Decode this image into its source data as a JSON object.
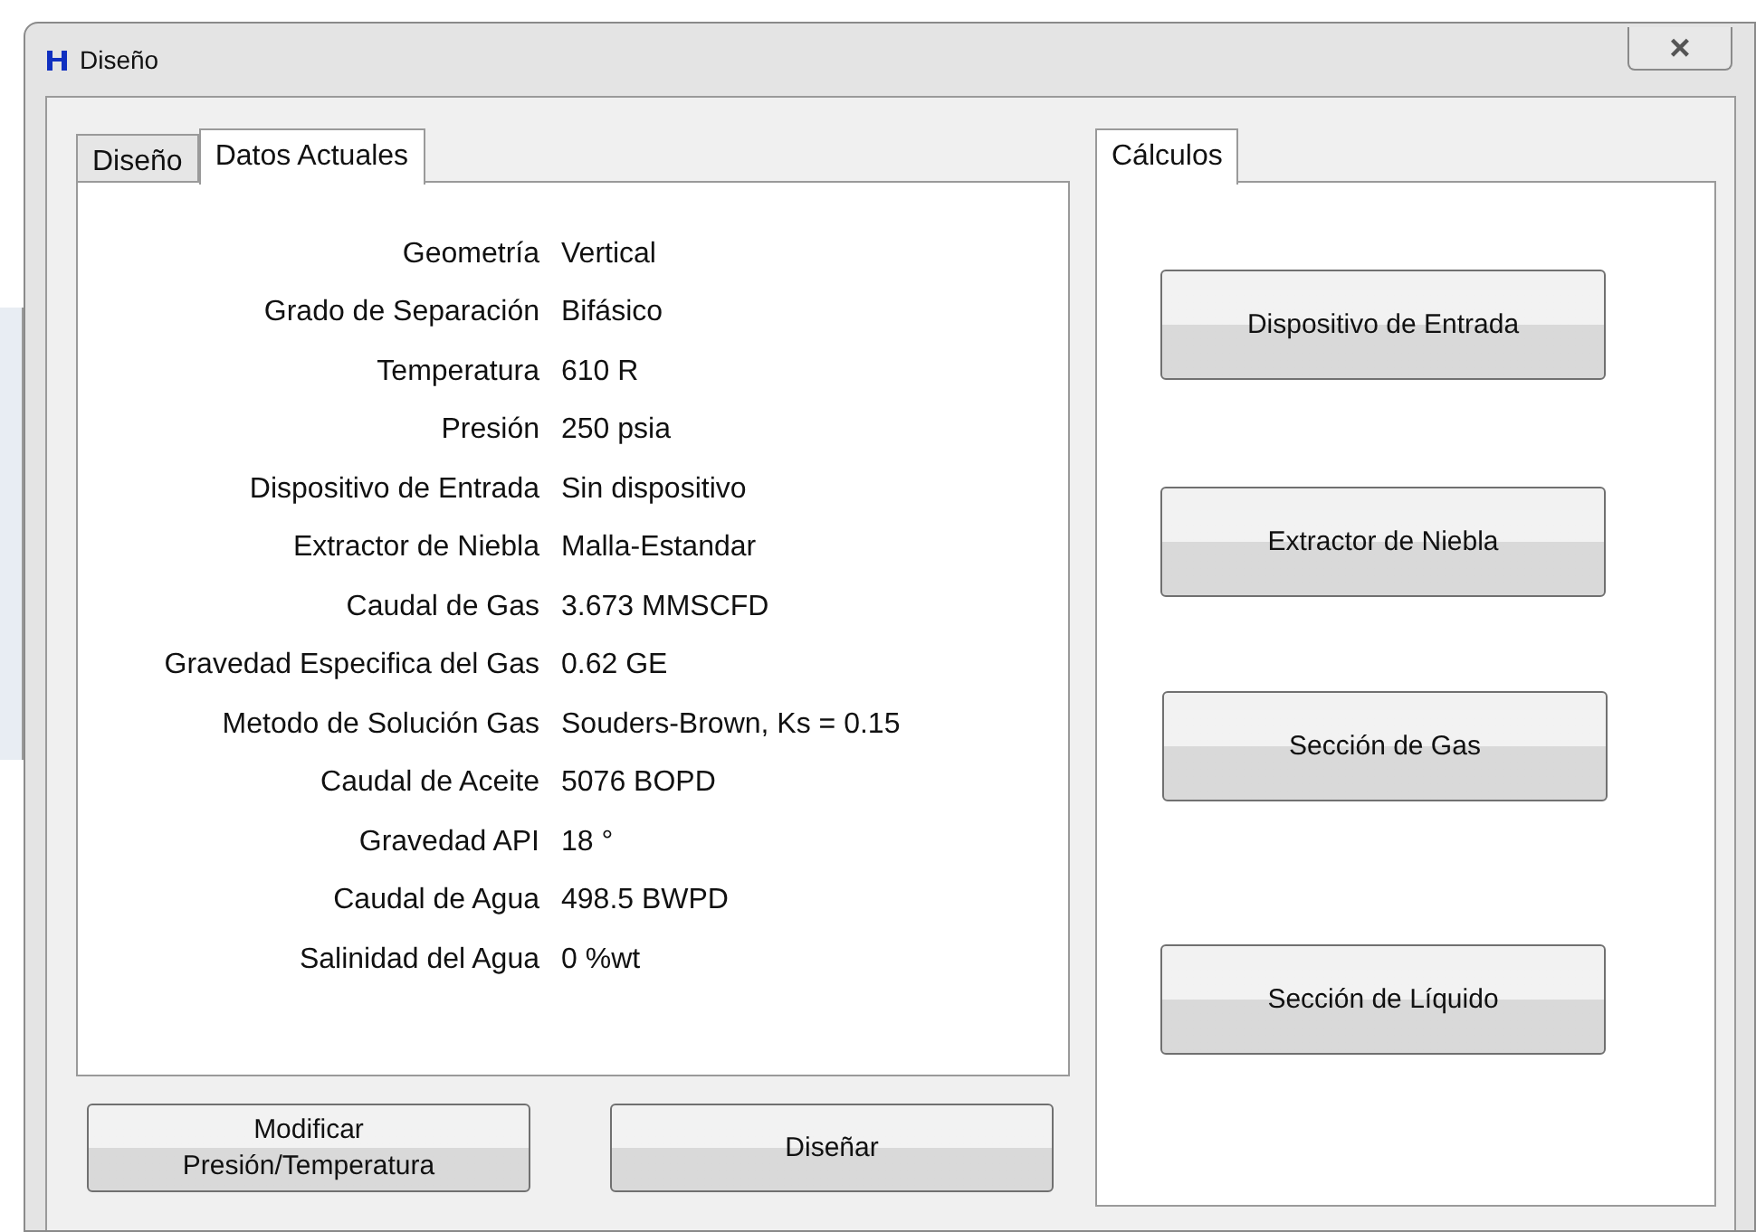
{
  "window": {
    "title": "Diseño",
    "close": "×"
  },
  "left_tabs": [
    {
      "label": "Diseño",
      "selected": false
    },
    {
      "label": "Datos Actuales",
      "selected": true
    }
  ],
  "fields": [
    {
      "label": "Geometría",
      "value": "Vertical"
    },
    {
      "label": "Grado de Separación",
      "value": "Bifásico"
    },
    {
      "label": "Temperatura",
      "value": "610 R"
    },
    {
      "label": "Presión",
      "value": "250 psia"
    },
    {
      "label": "Dispositivo de Entrada",
      "value": "Sin dispositivo"
    },
    {
      "label": "Extractor de Niebla",
      "value": "Malla-Estandar"
    },
    {
      "label": "Caudal de Gas",
      "value": "3.673 MMSCFD"
    },
    {
      "label": "Gravedad Especifica del Gas",
      "value": "0.62 GE"
    },
    {
      "label": "Metodo de Solución Gas",
      "value": "Souders-Brown, Ks = 0.15"
    },
    {
      "label": "Caudal de Aceite",
      "value": "5076 BOPD"
    },
    {
      "label": "Gravedad API",
      "value": "18 °"
    },
    {
      "label": "Caudal de Agua",
      "value": "498.5 BWPD"
    },
    {
      "label": "Salinidad del Agua",
      "value": "0 %wt"
    }
  ],
  "bottom_buttons": [
    [
      "Modificar",
      "Presión/Temperatura"
    ],
    [
      "Diseñar"
    ]
  ],
  "right_tabs": [
    {
      "label": "Cálculos",
      "selected": true
    }
  ],
  "calc_buttons": [
    "Dispositivo de Entrada",
    "Extractor de Niebla",
    "Sección de Gas",
    "Sección de Líquido"
  ]
}
